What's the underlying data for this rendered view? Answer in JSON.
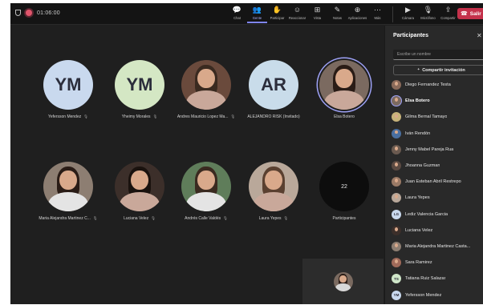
{
  "topbar": {
    "timer": "01:06:00",
    "tools": [
      {
        "icon": "chat-icon",
        "glyph": "💬",
        "label": "Chat",
        "active": false
      },
      {
        "icon": "people-icon",
        "glyph": "👥",
        "label": "Gente",
        "active": true
      },
      {
        "icon": "raise-hand-icon",
        "glyph": "✋",
        "label": "Participar",
        "active": false
      },
      {
        "icon": "reactions-icon",
        "glyph": "☺",
        "label": "Reaccionar",
        "active": false
      },
      {
        "icon": "view-icon",
        "glyph": "⊞",
        "label": "Vista",
        "active": false
      },
      {
        "icon": "notes-icon",
        "glyph": "✎",
        "label": "Notas",
        "active": false
      },
      {
        "icon": "apps-icon",
        "glyph": "⊕",
        "label": "Aplicaciones",
        "active": false
      },
      {
        "icon": "more-icon",
        "glyph": "⋯",
        "label": "Más",
        "active": false
      }
    ],
    "media": [
      {
        "icon": "camera-icon",
        "glyph": "▶",
        "label": "Cámara"
      },
      {
        "icon": "microphone-icon",
        "glyph": "🎙",
        "label": "Micrófono"
      },
      {
        "icon": "share-icon",
        "glyph": "⇪",
        "label": "Compartir"
      }
    ],
    "leave_label": "Salir"
  },
  "stage": {
    "tiles": [
      {
        "name": "Yefersson Mendez",
        "initials": "YM",
        "bg": "#c9d9ee",
        "muted": true,
        "photo": false
      },
      {
        "name": "Yheimy Morales",
        "initials": "YM",
        "bg": "#d4e7c4",
        "muted": true,
        "photo": false
      },
      {
        "name": "Andres Mauricio Lopez Ma...",
        "initials": "",
        "bg": "#6a4a3c",
        "muted": true,
        "photo": true
      },
      {
        "name": "ALEJANDRO RISK (Invitado)",
        "initials": "AR",
        "bg": "#c9dcea",
        "muted": false,
        "photo": false
      },
      {
        "name": "Elsa Botero",
        "initials": "",
        "bg": "#7b6a60",
        "muted": false,
        "photo": true,
        "speaking": true
      },
      {
        "name": "Maria Alejandra Martinez C...",
        "initials": "",
        "bg": "#8d7e72",
        "muted": true,
        "photo": true
      },
      {
        "name": "Luciana Velez",
        "initials": "",
        "bg": "#3c2f2a",
        "muted": true,
        "photo": true
      },
      {
        "name": "Andrés Calle Valdés",
        "initials": "",
        "bg": "#5f7d5a",
        "muted": true,
        "photo": true
      },
      {
        "name": "Laura Yepes",
        "initials": "",
        "bg": "#b9a89a",
        "muted": true,
        "photo": true
      },
      {
        "name": "Participantes",
        "initials": "22",
        "bg": "#0d0d0d",
        "muted": false,
        "photo": false
      }
    ]
  },
  "panel": {
    "title": "Participantes",
    "search_placeholder": "Escribe un nombre",
    "invite_label": "Compartir invitación",
    "people": [
      {
        "name": "Diego Fernandez Testa",
        "initials": "",
        "bg": "#8a6a5a",
        "bold": false
      },
      {
        "name": "Elsa Botero",
        "initials": "",
        "bg": "#7b6a60",
        "bold": true
      },
      {
        "name": "Gilma Bernal Tamayo",
        "initials": "",
        "bg": "#c7b37a",
        "bold": false
      },
      {
        "name": "Iván Rendón",
        "initials": "",
        "bg": "#4a6fa0",
        "bold": false
      },
      {
        "name": "Jenny Mabel Pareja Rua",
        "initials": "",
        "bg": "#6a5a50",
        "bold": false
      },
      {
        "name": "Jhoanna Guzman",
        "initials": "",
        "bg": "#5a4a42",
        "bold": false
      },
      {
        "name": "Juan Esteban Abril Restrepo",
        "initials": "",
        "bg": "#9a7a66",
        "bold": false
      },
      {
        "name": "Laura Yepes",
        "initials": "",
        "bg": "#b9a89a",
        "bold": false
      },
      {
        "name": "Lediz Valencia Garcia",
        "initials": "LG",
        "bg": "#c9d9ee",
        "bold": false
      },
      {
        "name": "Luciana Velez",
        "initials": "",
        "bg": "#3c2f2a",
        "bold": false
      },
      {
        "name": "Maria Alejandra Martinez Casta...",
        "initials": "",
        "bg": "#8d7e72",
        "bold": false
      },
      {
        "name": "Sara Ramirez",
        "initials": "",
        "bg": "#a06a5a",
        "bold": false
      },
      {
        "name": "Tatiana Ruiz Salazar",
        "initials": "TS",
        "bg": "#cfe6c9",
        "bold": false
      },
      {
        "name": "Yefersson Mendez",
        "initials": "YM",
        "bg": "#c9d9ee",
        "bold": false
      }
    ]
  }
}
